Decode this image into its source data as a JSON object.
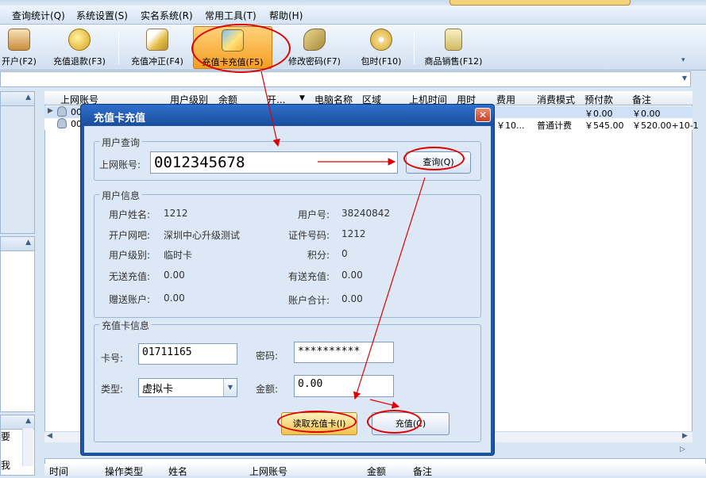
{
  "menu": [
    "查询统计(Q)",
    "系统设置(S)",
    "实名系统(R)",
    "常用工具(T)",
    "帮助(H)"
  ],
  "toolbar": {
    "buttons": [
      {
        "label": "开户(F2)",
        "icon": "open-account-icon"
      },
      {
        "label": "充值退款(F3)",
        "icon": "refund-coins-icon"
      },
      {
        "label": "充值冲正(F4)",
        "icon": "correction-icon"
      },
      {
        "label": "充值卡充值(F5)",
        "icon": "card-recharge-icon"
      },
      {
        "label": "修改密码(F7)",
        "icon": "key-icon"
      },
      {
        "label": "包时(F10)",
        "icon": "disc-icon"
      },
      {
        "label": "商品销售(F12)",
        "icon": "bottle-icon"
      }
    ]
  },
  "grid": {
    "headers": [
      "上网账号",
      "用户级别",
      "余额",
      "开...",
      "电脑名称",
      "区域",
      "上机时间",
      "用时",
      "费用",
      "消费模式",
      "预付款",
      "备注"
    ],
    "rows": [
      {
        "account": "00",
        "fee": "",
        "mode": "",
        "prepaid": "￥0.00",
        "remark": "￥0.00"
      },
      {
        "account": "00",
        "fee": "￥10...",
        "mode": "普通计费",
        "prepaid": "￥545.00",
        "remark": "￥520.00+10-1"
      }
    ]
  },
  "bottom_grid": {
    "headers": [
      "时间",
      "操作类型",
      "姓名",
      "上网账号",
      "金额",
      "备注"
    ]
  },
  "left_panes": {
    "bottom_texts": [
      "要",
      "我"
    ]
  },
  "dialog": {
    "title": "充值卡充值",
    "close": "✕",
    "user_query": {
      "group_title": "用户查询",
      "account_label": "上网账号:",
      "account_value": "0012345678",
      "query_button": "查询(Q)"
    },
    "user_info": {
      "group_title": "用户信息",
      "fields": [
        {
          "label": "用户姓名:",
          "value": "1212"
        },
        {
          "label": "用户号:",
          "value": "38240842"
        },
        {
          "label": "开户网吧:",
          "value": "深圳中心升级测试"
        },
        {
          "label": "证件号码:",
          "value": "1212"
        },
        {
          "label": "用户级别:",
          "value": "临时卡"
        },
        {
          "label": "积分:",
          "value": "0"
        },
        {
          "label": "无送充值:",
          "value": "0.00"
        },
        {
          "label": "有送充值:",
          "value": "0.00"
        },
        {
          "label": "赠送账户:",
          "value": "0.00"
        },
        {
          "label": "账户合计:",
          "value": "0.00"
        }
      ]
    },
    "card_info": {
      "group_title": "充值卡信息",
      "card_no_label": "卡号:",
      "card_no_value": "01711165",
      "password_label": "密码:",
      "password_value": "**********",
      "type_label": "类型:",
      "type_value": "虚拟卡",
      "amount_label": "金额:",
      "amount_value": "0.00"
    },
    "buttons": {
      "read_card": "读取充值卡(I)",
      "recharge": "充值(C)"
    }
  },
  "colors": {
    "annotation_red": "#e00000",
    "dialog_blue": "#1d55a8",
    "active_tab_orange": "#f59d22"
  }
}
